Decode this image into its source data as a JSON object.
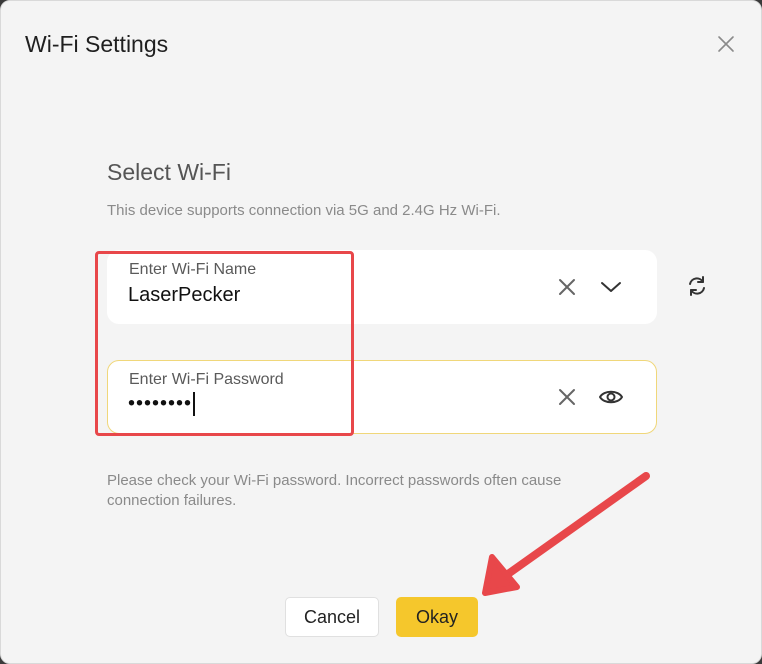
{
  "dialog": {
    "title": "Wi-Fi Settings"
  },
  "section": {
    "title": "Select Wi-Fi",
    "subtitle": "This device supports connection via 5G and 2.4G Hz Wi-Fi."
  },
  "wifi_name": {
    "label": "Enter Wi-Fi Name",
    "value": "LaserPecker"
  },
  "wifi_password": {
    "label": "Enter Wi-Fi Password",
    "value": "••••••••"
  },
  "hint": "Please check your Wi-Fi password. Incorrect passwords often cause connection failures.",
  "buttons": {
    "cancel": "Cancel",
    "okay": "Okay"
  },
  "colors": {
    "accent": "#f5c72c",
    "annotation": "#e8474a",
    "password_border": "#f0d77a"
  },
  "icons": {
    "close": "close-icon",
    "refresh": "refresh-icon",
    "clear": "clear-icon",
    "dropdown": "chevron-down-icon",
    "show_password": "eye-icon"
  }
}
